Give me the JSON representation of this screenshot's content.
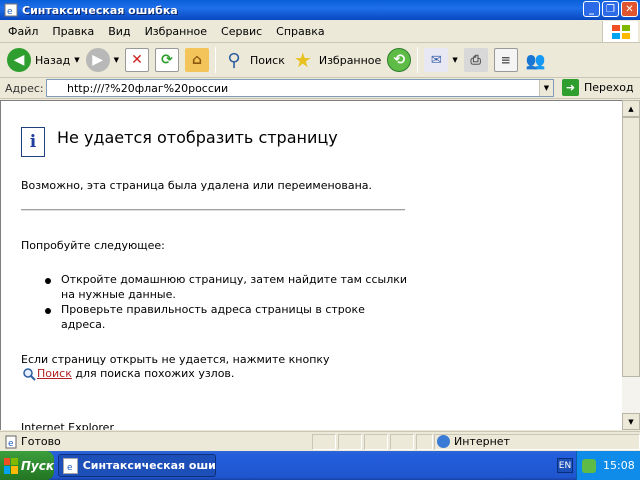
{
  "window": {
    "title": "Синтаксическая ошибка"
  },
  "menu": {
    "items": [
      "Файл",
      "Правка",
      "Вид",
      "Избранное",
      "Сервис",
      "Справка"
    ]
  },
  "toolbar": {
    "back_label": "Назад",
    "search_label": "Поиск",
    "favorites_label": "Избранное"
  },
  "address": {
    "label": "Адрес:",
    "value": "http:///?%20флаг%20россии",
    "go_label": "Переход"
  },
  "page": {
    "title": "Не удается отобразить страницу",
    "line1": "Возможно, эта страница была удалена или переименована.",
    "try_heading": "Попробуйте следующее:",
    "bullet1_a": "Откройте домашнюю страницу, затем найдите там ссылки",
    "bullet1_b": "на нужные данные.",
    "bullet2_a": "Проверьте правильность адреса страницы в строке",
    "bullet2_b": "адреса.",
    "fail_line": "Если страницу открыть не удается, нажмите кнопку",
    "search_link": "Поиск",
    "search_suffix": " для поиска похожих узлов.",
    "footer": "Internet Explorer"
  },
  "status": {
    "text": "Готово",
    "zone": "Интернет"
  },
  "taskbar": {
    "start_label": "Пуск",
    "task_label": "Синтаксическая оши...",
    "lang": "EN",
    "clock": "15:08"
  }
}
